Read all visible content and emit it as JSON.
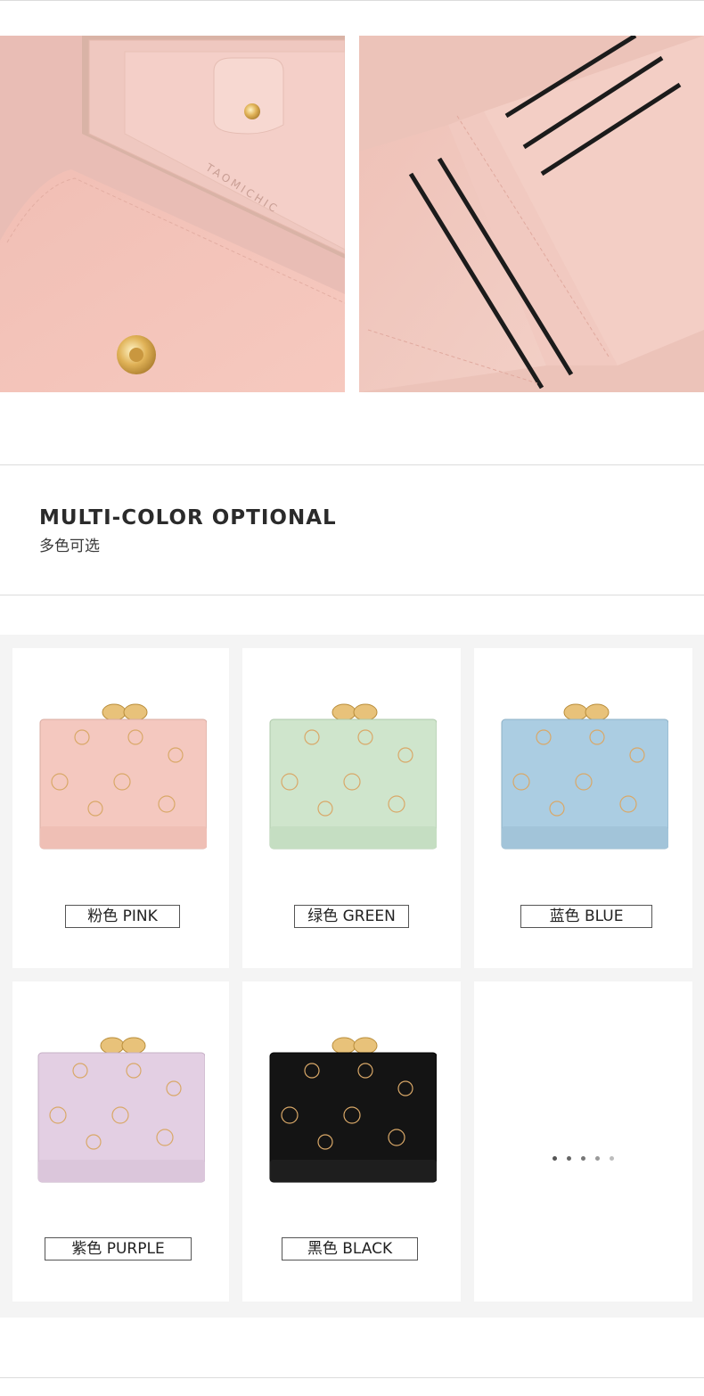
{
  "heading": {
    "title_en": "MULTI-COLOR OPTIONAL",
    "title_cn": "多色可选"
  },
  "photos": {
    "left_card_text": "TAOMICHIC"
  },
  "colors": {
    "pink": "#f4c8bf",
    "green": "#cfe5cc",
    "blue": "#abcde2",
    "purple": "#e3cfe3",
    "black": "#141414",
    "clasp": "#e8c27a"
  },
  "variants": [
    {
      "label": "粉色 PINK"
    },
    {
      "label": "绿色 GREEN"
    },
    {
      "label": "蓝色 BLUE"
    },
    {
      "label": "紫色 PURPLE"
    },
    {
      "label": "黑色 BLACK"
    }
  ],
  "dots": {
    "count": 5,
    "active_count": 3
  }
}
